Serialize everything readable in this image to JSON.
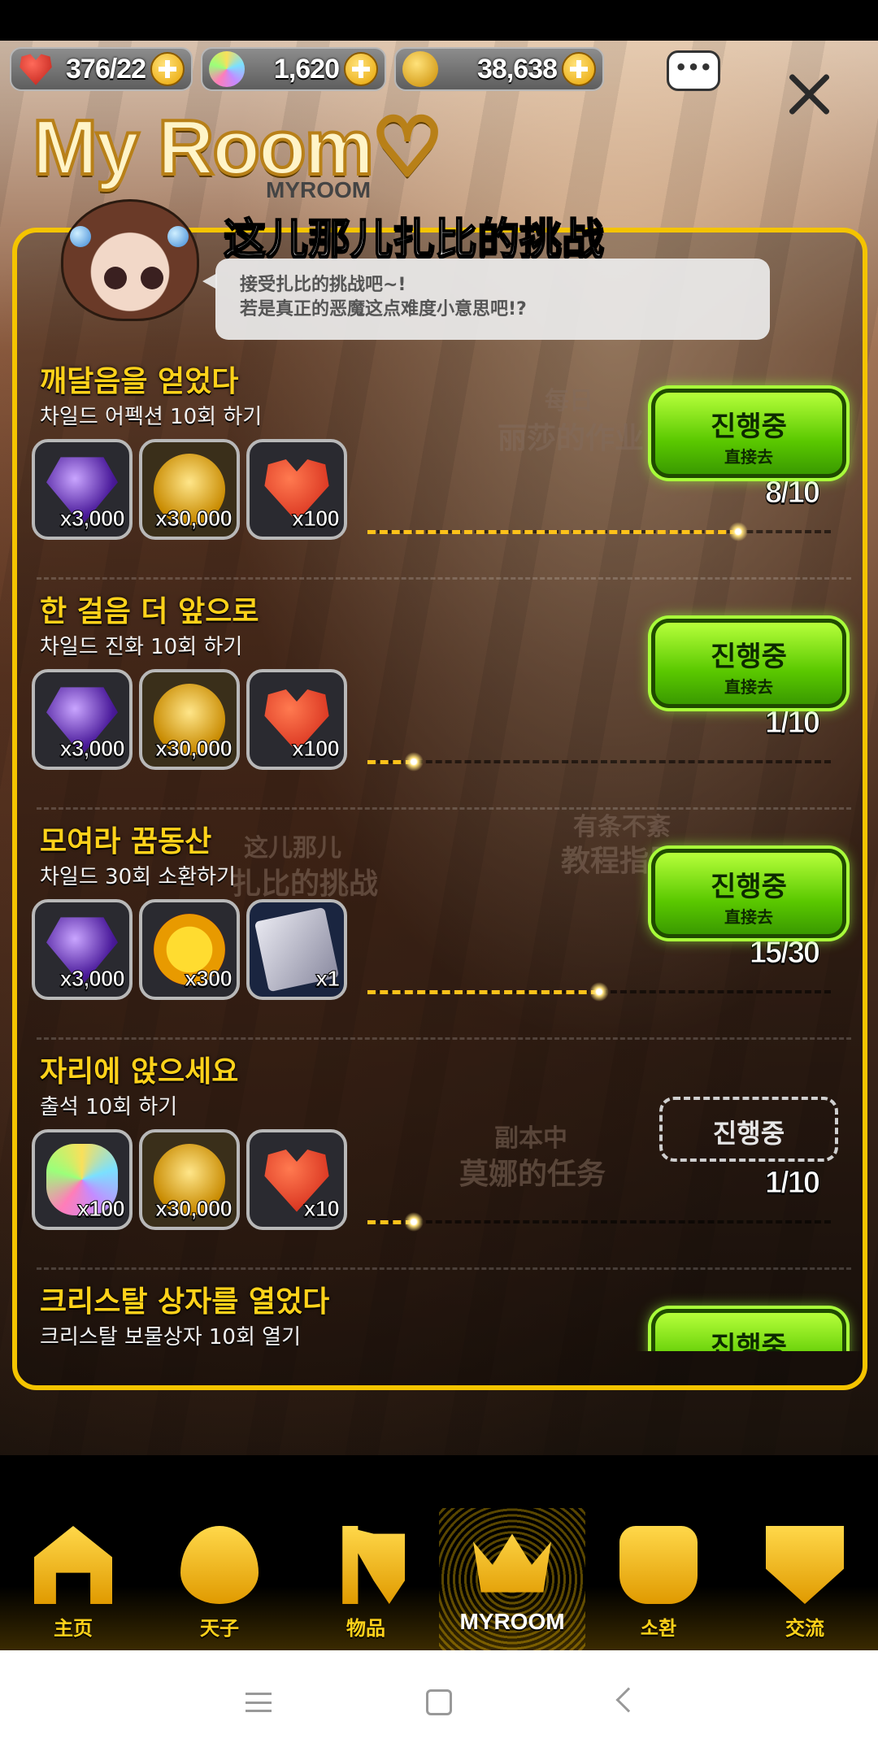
{
  "resources": {
    "hearts": "376/22",
    "gems": "1,620",
    "gold": "38,638"
  },
  "header": {
    "title": "My Room",
    "subtitle": "MYROOM"
  },
  "challenge": {
    "title": "这儿那儿扎比的挑战",
    "speech_line1": "接受扎比的挑战吧~!",
    "speech_line2": "若是真正的恶魔这点难度小意思吧!?"
  },
  "background_labels": {
    "daily": "每日",
    "lisa_homework": "丽莎的作业",
    "orderly": "有条不紊",
    "tutorial": "教程指导",
    "here_there": "这儿那儿",
    "zabi_challenge": "扎比的挑战",
    "dungeon": "副本中",
    "mona_task": "莫娜的任务"
  },
  "quests": [
    {
      "title": "깨달음을 얻었다",
      "desc": "차일드 어펙션 10회 하기",
      "rewards": [
        {
          "icon": "purple-crystal",
          "qty": "x3,000"
        },
        {
          "icon": "gold-coins",
          "qty": "x30,000"
        },
        {
          "icon": "red-heart",
          "qty": "x100"
        }
      ],
      "count": "8/10",
      "progress": 0.8,
      "button_main": "진행중",
      "button_sub": "直接去",
      "active": true
    },
    {
      "title": "한 걸음 더 앞으로",
      "desc": "차일드 진화 10회 하기",
      "rewards": [
        {
          "icon": "purple-crystal",
          "qty": "x3,000"
        },
        {
          "icon": "gold-coins",
          "qty": "x30,000"
        },
        {
          "icon": "red-heart",
          "qty": "x100"
        }
      ],
      "count": "1/10",
      "progress": 0.1,
      "button_main": "진행중",
      "button_sub": "直接去",
      "active": true
    },
    {
      "title": "모여라 꿈동산",
      "desc": "차일드 30회 소환하기",
      "rewards": [
        {
          "icon": "purple-crystal",
          "qty": "x3,000"
        },
        {
          "icon": "star-medal",
          "qty": "x300"
        },
        {
          "icon": "ticket-card",
          "qty": "x1"
        }
      ],
      "count": "15/30",
      "progress": 0.5,
      "button_main": "진행중",
      "button_sub": "直接去",
      "active": true
    },
    {
      "title": "자리에 앉으세요",
      "desc": "출석 10회 하기",
      "rewards": [
        {
          "icon": "rainbow-gem",
          "qty": "x100"
        },
        {
          "icon": "gold-coins",
          "qty": "x30,000"
        },
        {
          "icon": "red-heart",
          "qty": "x10"
        }
      ],
      "count": "1/10",
      "progress": 0.1,
      "button_main": "진행중",
      "button_sub": "",
      "active": false
    },
    {
      "title": "크리스탈 상자를 열었다",
      "desc": "크리스탈 보물상자 10회 열기",
      "rewards": [],
      "count": "",
      "progress": 0,
      "button_main": "진행중",
      "button_sub": "",
      "active": true
    }
  ],
  "nav": {
    "home": "主页",
    "tianzi": "天子",
    "items": "物品",
    "myroom": "MYROOM",
    "summon": "소환",
    "exchange": "交流"
  },
  "colors": {
    "accent_yellow": "#f4c400",
    "button_green": "#5ac800",
    "quest_title": "#ffd21a"
  }
}
